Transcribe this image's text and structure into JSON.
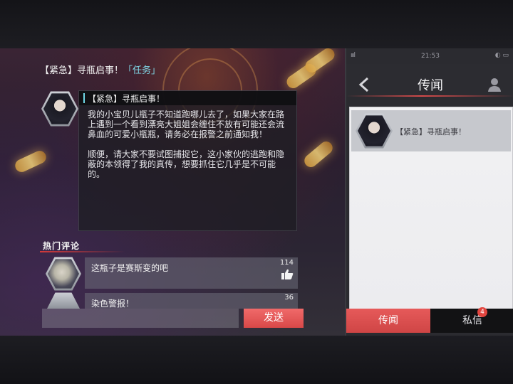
{
  "event": {
    "title_prefix": "【紧急】寻瓶启事！",
    "title_tag": "「任务」"
  },
  "post": {
    "title": "【紧急】寻瓶启事！",
    "paragraphs": [
      "我的小宝贝儿瓶子不知道跑哪儿去了，如果大家在路上遇到一个看到漂亮大姐姐会缠住不放有可能还会流鼻血的可爱小瓶瓶，请务必在报警之前通知我！",
      "顺便，请大家不要试图捕捉它，这小家伙的逃跑和隐蔽的本领得了我的真传，想要抓住它几乎是不可能的。"
    ]
  },
  "comments": {
    "section_label": "热门评论",
    "items": [
      {
        "text": "这瓶子是赛斯变的吧",
        "likes": "114"
      },
      {
        "text": "染色警报！",
        "likes": "36"
      }
    ]
  },
  "composer": {
    "input_value": "",
    "send_label": "发送"
  },
  "phone": {
    "status_left": "ıııl",
    "time": "21:53",
    "status_right": "◐ ▭",
    "title": "传闻",
    "feed": [
      {
        "text": "【紧急】寻瓶启事！"
      }
    ],
    "tabs": {
      "news_label": "传闻",
      "dm_label": "私信",
      "dm_badge": "4"
    }
  },
  "colors": {
    "accent_red": "#e0524f",
    "tag_cyan": "#7fd6e6"
  }
}
